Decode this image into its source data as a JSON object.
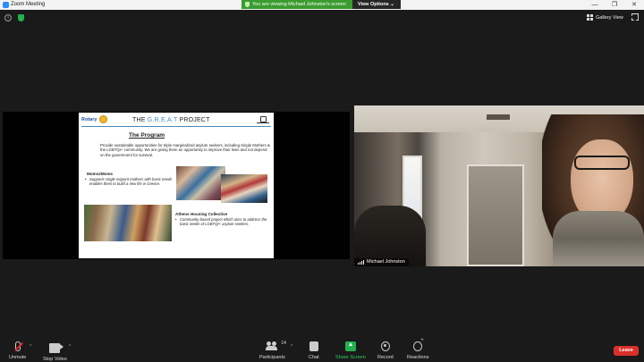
{
  "window": {
    "title": "Zoom Meeting",
    "minimize_glyph": "—",
    "maximize_glyph": "❐",
    "close_glyph": "✕"
  },
  "banner": {
    "viewing_text": "You are viewing Michael Johnston's screen",
    "view_options": "View Options ⌄"
  },
  "top_right": {
    "gallery_view": "Gallery View"
  },
  "slide": {
    "org": "Rotary",
    "title_prefix": "THE ",
    "title_accent": "G.R.E.A.T",
    "title_suffix": " PROJECT",
    "heading": "The Program",
    "intro": "Provide sustainable opportunities for triple marginalized asylum seekers, including Single Mothers & the LGBTQI+ community.  We are giving them an opportunity to improve their lives and not depend on the government for survival.",
    "moms_title": "Moms2Moms",
    "moms_text": "Supports single migrant mothers with basic needs enables them to build a new life in Greece.",
    "athens_title": "Athens Housing Collective",
    "athens_text": "Community-based project which aims to address the basic needs of LGBTQI+  asylum seekers."
  },
  "video": {
    "participant_name": "Michael Johnston"
  },
  "toolbar": {
    "unmute": "Unmute",
    "stop_video": "Stop Video",
    "participants": "Participants",
    "participants_count": "14",
    "chat": "Chat",
    "share_screen": "Share Screen",
    "record": "Record",
    "reactions": "Reactions",
    "leave": "Leave",
    "caret": "^"
  },
  "colors": {
    "share_green": "#23b14d",
    "banner_green": "#3a9b2e",
    "leave_red": "#d9302b",
    "zoom_blue": "#2d8cff"
  }
}
